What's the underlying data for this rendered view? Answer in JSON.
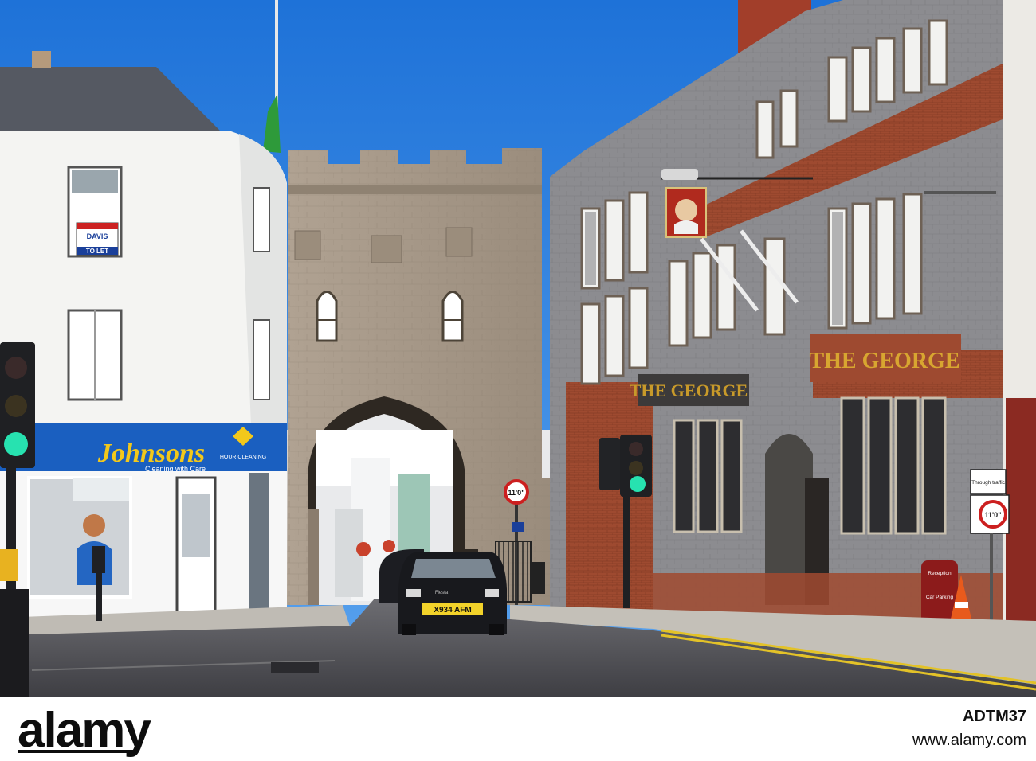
{
  "photo": {
    "colors": {
      "sky": "#1f7be0",
      "stone": "#a39585",
      "brick": "#a04a30",
      "white_building": "#f4f4f2",
      "road": "#4d4d52",
      "shop_blue": "#1a5fc0"
    },
    "signs": {
      "johnsons": "Johnsons",
      "johnsons_tagline": "Cleaning with Care",
      "hour_cleaning": "HOUR CLEANING",
      "davis": "DAVIS",
      "to_let": "TO LET",
      "the_george_left": "THE GEORGE",
      "the_george_right": "THE GEORGE",
      "height_limit": "11'0\"",
      "height_limit_right": "11'0\"",
      "through_traffic": "Through traffic",
      "reception": "Reception",
      "car_parking": "Car Parking",
      "number_plate": "X934 AFM",
      "car_badge": "Fiesta"
    }
  },
  "watermark": {
    "brand": "alamy",
    "image_id": "ADTM37",
    "url": "www.alamy.com"
  }
}
